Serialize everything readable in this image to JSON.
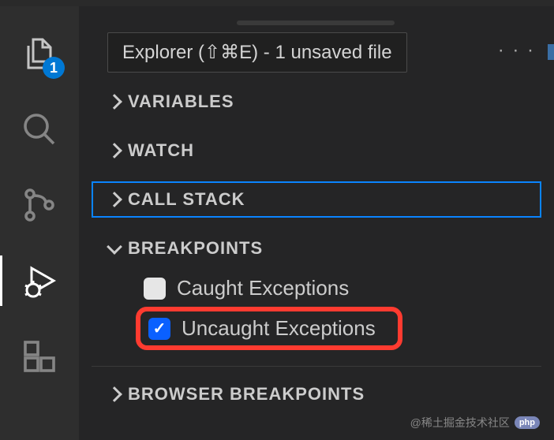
{
  "window": {
    "explorer_badge": "1"
  },
  "tooltip": {
    "text": "Explorer (⇧⌘E) - 1 unsaved file"
  },
  "debug": {
    "sections": {
      "variables": {
        "title": "VARIABLES",
        "expanded": false
      },
      "watch": {
        "title": "WATCH",
        "expanded": false
      },
      "callstack": {
        "title": "CALL STACK",
        "expanded": false,
        "selected": true
      },
      "breakpoints": {
        "title": "BREAKPOINTS",
        "expanded": true,
        "items": [
          {
            "label": "Caught Exceptions",
            "checked": false
          },
          {
            "label": "Uncaught Exceptions",
            "checked": true,
            "highlighted": true
          }
        ]
      },
      "browser_breakpoints": {
        "title": "BROWSER BREAKPOINTS",
        "expanded": false
      }
    }
  },
  "watermark": {
    "text": "@稀土掘金技术社区",
    "logo": "php"
  }
}
